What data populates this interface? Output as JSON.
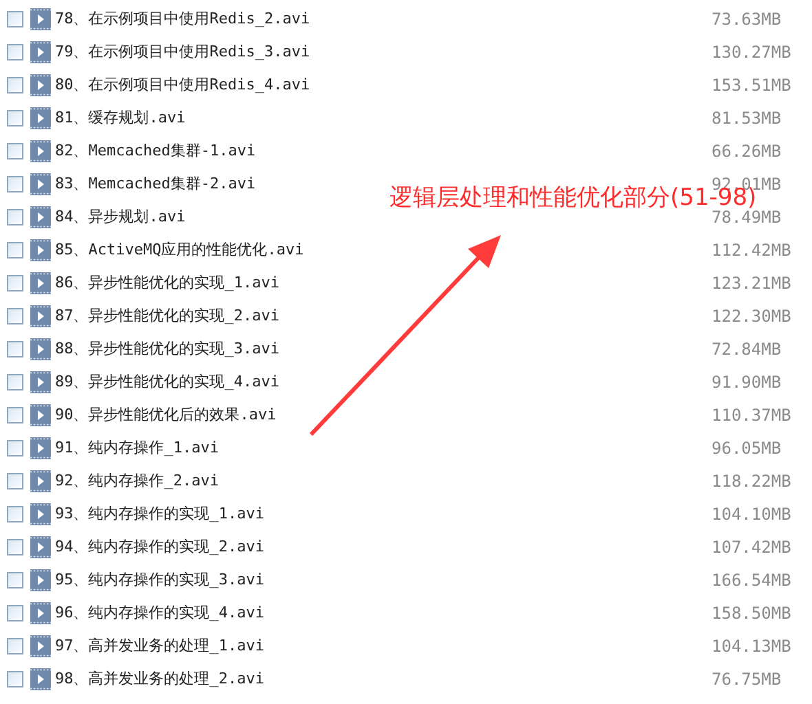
{
  "files": [
    {
      "name": "78、在示例项目中使用Redis_2.avi",
      "size": "73.63MB",
      "checked": false
    },
    {
      "name": "79、在示例项目中使用Redis_3.avi",
      "size": "130.27MB",
      "checked": false
    },
    {
      "name": "80、在示例项目中使用Redis_4.avi",
      "size": "153.51MB",
      "checked": false
    },
    {
      "name": "81、缓存规划.avi",
      "size": "81.53MB",
      "checked": false
    },
    {
      "name": "82、Memcached集群-1.avi",
      "size": "66.26MB",
      "checked": false
    },
    {
      "name": "83、Memcached集群-2.avi",
      "size": "92.01MB",
      "checked": false
    },
    {
      "name": "84、异步规划.avi",
      "size": "78.49MB",
      "checked": false
    },
    {
      "name": "85、ActiveMQ应用的性能优化.avi",
      "size": "112.42MB",
      "checked": false
    },
    {
      "name": "86、异步性能优化的实现_1.avi",
      "size": "123.21MB",
      "checked": false
    },
    {
      "name": "87、异步性能优化的实现_2.avi",
      "size": "122.30MB",
      "checked": false
    },
    {
      "name": "88、异步性能优化的实现_3.avi",
      "size": "72.84MB",
      "checked": false
    },
    {
      "name": "89、异步性能优化的实现_4.avi",
      "size": "91.90MB",
      "checked": false
    },
    {
      "name": "90、异步性能优化后的效果.avi",
      "size": "110.37MB",
      "checked": false
    },
    {
      "name": "91、纯内存操作_1.avi",
      "size": "96.05MB",
      "checked": false
    },
    {
      "name": "92、纯内存操作_2.avi",
      "size": "118.22MB",
      "checked": false
    },
    {
      "name": "93、纯内存操作的实现_1.avi",
      "size": "104.10MB",
      "checked": false
    },
    {
      "name": "94、纯内存操作的实现_2.avi",
      "size": "107.42MB",
      "checked": false
    },
    {
      "name": "95、纯内存操作的实现_3.avi",
      "size": "166.54MB",
      "checked": false
    },
    {
      "name": "96、纯内存操作的实现_4.avi",
      "size": "158.50MB",
      "checked": false
    },
    {
      "name": "97、高并发业务的处理_1.avi",
      "size": "104.13MB",
      "checked": false
    },
    {
      "name": "98、高并发业务的处理_2.avi",
      "size": "76.75MB",
      "checked": false
    }
  ],
  "annotation": {
    "text": "逻辑层处理和性能优化部分(51-98)"
  }
}
